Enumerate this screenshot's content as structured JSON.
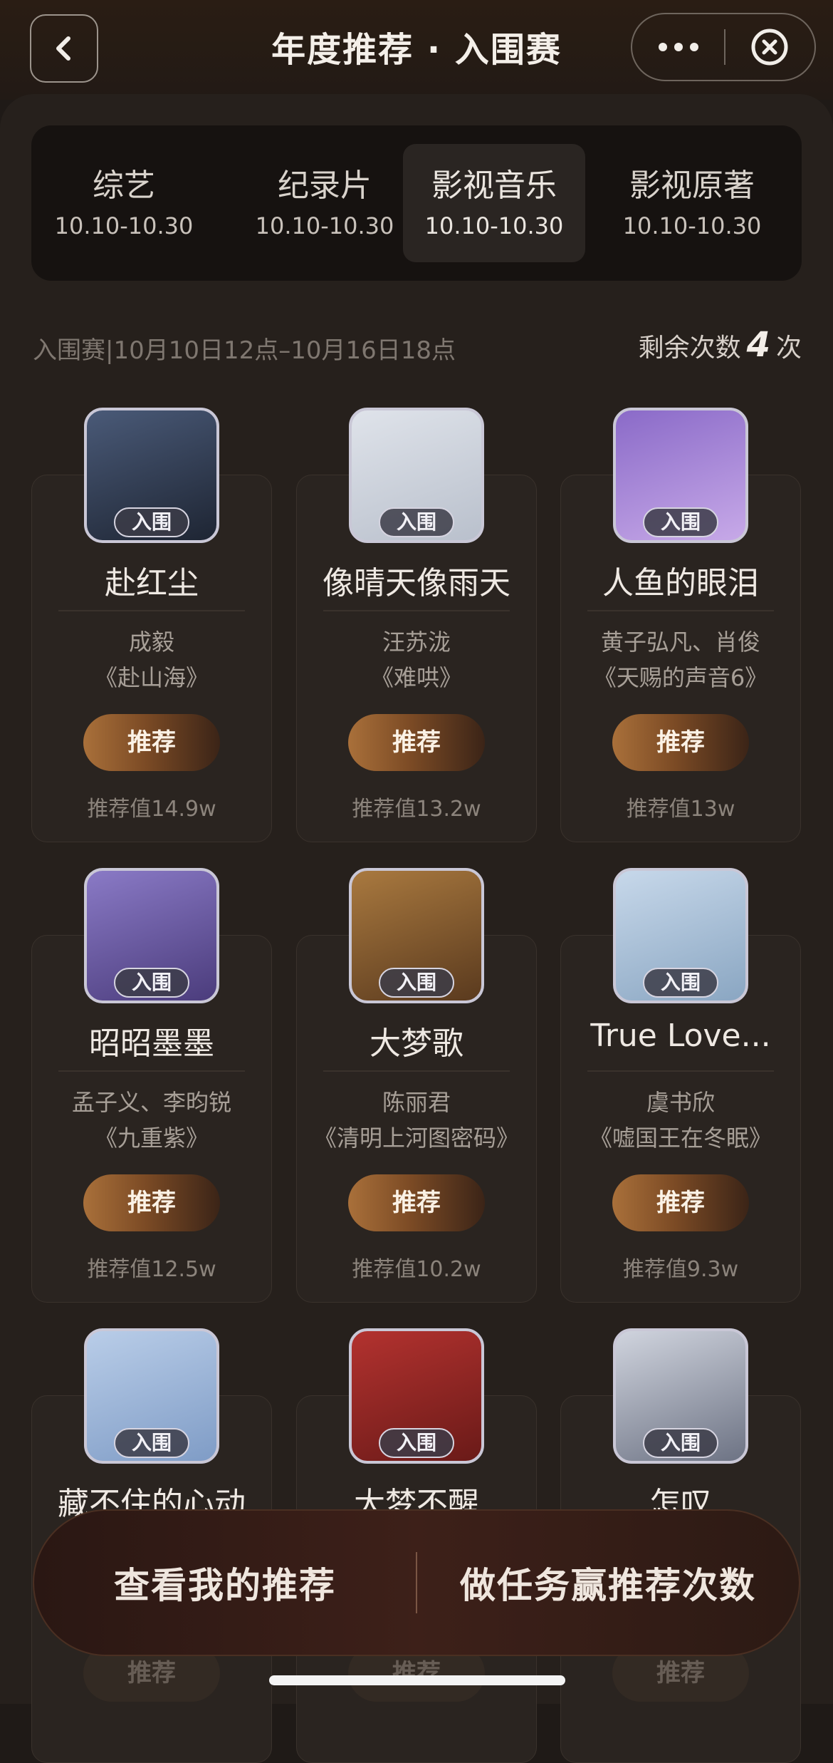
{
  "header": {
    "title": "年度推荐 · 入围赛"
  },
  "tabs": [
    {
      "name": "综艺",
      "date": "10.10-10.30"
    },
    {
      "name": "纪录片",
      "date": "10.10-10.30"
    },
    {
      "name": "影视音乐",
      "date": "10.10-10.30"
    },
    {
      "name": "影视原著",
      "date": "10.10-10.30"
    }
  ],
  "info": {
    "period": "入围赛|10月10日12点–10月16日18点",
    "remaining_label": "剩余次数",
    "remaining_count": "4",
    "remaining_unit": "次"
  },
  "cards": [
    {
      "badge": "入围",
      "song": "赴红尘",
      "artist": "成毅",
      "album": "《赴山海》",
      "button": "推荐",
      "value": "推荐值14.9w",
      "cover_colors": [
        "#4a5a78",
        "#1e2533"
      ]
    },
    {
      "badge": "入围",
      "song": "像晴天像雨天",
      "artist": "汪苏泷",
      "album": "《难哄》",
      "button": "推荐",
      "value": "推荐值13.2w",
      "cover_colors": [
        "#dfe3ea",
        "#b9c0cc"
      ]
    },
    {
      "badge": "入围",
      "song": "人鱼的眼泪",
      "artist": "黄子弘凡、肖俊",
      "album": "《天赐的声音6》",
      "button": "推荐",
      "value": "推荐值13w",
      "cover_colors": [
        "#8a6ac8",
        "#c7a9e8"
      ]
    },
    {
      "badge": "入围",
      "song": "昭昭墨墨",
      "artist": "孟子义、李昀锐",
      "album": "《九重紫》",
      "button": "推荐",
      "value": "推荐值12.5w",
      "cover_colors": [
        "#8a7ac6",
        "#4b3c7c"
      ]
    },
    {
      "badge": "入围",
      "song": "大梦歌",
      "artist": "陈丽君",
      "album": "《清明上河图密码》",
      "button": "推荐",
      "value": "推荐值10.2w",
      "cover_colors": [
        "#a9793f",
        "#5a3a1e"
      ]
    },
    {
      "badge": "入围",
      "song": "True Love...",
      "artist": "虞书欣",
      "album": "《嘘国王在冬眠》",
      "button": "推荐",
      "value": "推荐值9.3w",
      "cover_colors": [
        "#c7d8ea",
        "#8aa6c2"
      ]
    },
    {
      "badge": "入围",
      "song": "藏不住的心动",
      "artist": "",
      "album": "",
      "button": "推荐",
      "value": "",
      "cover_colors": [
        "#b9cde8",
        "#7f9cc6"
      ]
    },
    {
      "badge": "入围",
      "song": "大梦不醒",
      "artist": "",
      "album": "",
      "button": "推荐",
      "value": "",
      "cover_colors": [
        "#b3322f",
        "#6a1a18"
      ]
    },
    {
      "badge": "入围",
      "song": "怎叹",
      "artist": "",
      "album": "",
      "button": "推荐",
      "value": "",
      "cover_colors": [
        "#d0d4de",
        "#6d7384"
      ]
    }
  ],
  "bottom": {
    "my_recommend": "查看我的推荐",
    "earn_tasks": "做任务赢推荐次数"
  },
  "colors": {
    "background": "#1f1a17",
    "panel": "#26201c",
    "button_gradient_start": "#a9703a",
    "button_gradient_end": "#3b2417",
    "accent_text": "#f3eee8"
  },
  "icons": [
    "back-chevron-icon",
    "more-dots-icon",
    "close-circle-icon"
  ]
}
